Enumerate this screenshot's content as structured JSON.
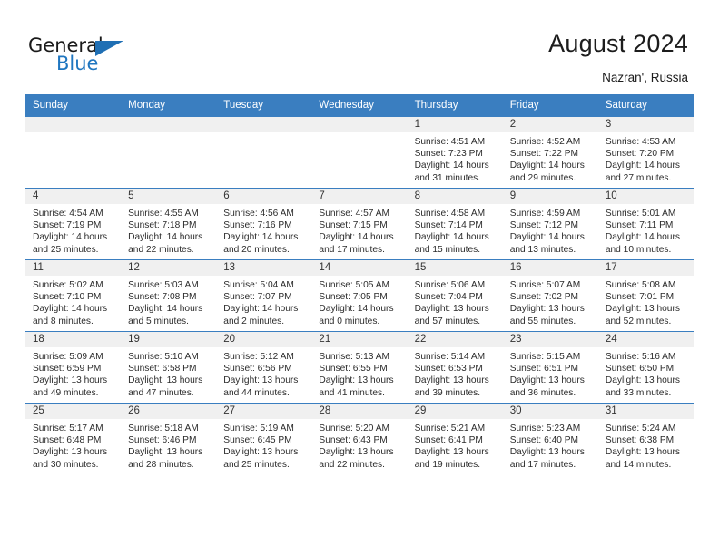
{
  "brand": {
    "name_part1": "General",
    "name_part2": "Blue",
    "flag_icon": "triangle-flag-icon",
    "accent_color": "#1f6fb4"
  },
  "header": {
    "title": "August 2024",
    "location": "Nazran', Russia"
  },
  "theme": {
    "header_bg": "#3a7ec0",
    "header_text": "#ffffff",
    "daynum_band_bg": "#f0f0f0",
    "cell_bg": "#ffffff",
    "grid_line": "#3a7ec0",
    "body_text": "#2b2b2b"
  },
  "calendar": {
    "weekday_headers": [
      "Sunday",
      "Monday",
      "Tuesday",
      "Wednesday",
      "Thursday",
      "Friday",
      "Saturday"
    ],
    "labels": {
      "sunrise": "Sunrise:",
      "sunset": "Sunset:",
      "daylight": "Daylight:"
    },
    "weeks": [
      [
        {
          "day": "",
          "blank": true
        },
        {
          "day": "",
          "blank": true
        },
        {
          "day": "",
          "blank": true
        },
        {
          "day": "",
          "blank": true
        },
        {
          "day": "1",
          "sunrise": "Sunrise: 4:51 AM",
          "sunset": "Sunset: 7:23 PM",
          "daylight": "Daylight: 14 hours and 31 minutes."
        },
        {
          "day": "2",
          "sunrise": "Sunrise: 4:52 AM",
          "sunset": "Sunset: 7:22 PM",
          "daylight": "Daylight: 14 hours and 29 minutes."
        },
        {
          "day": "3",
          "sunrise": "Sunrise: 4:53 AM",
          "sunset": "Sunset: 7:20 PM",
          "daylight": "Daylight: 14 hours and 27 minutes."
        }
      ],
      [
        {
          "day": "4",
          "sunrise": "Sunrise: 4:54 AM",
          "sunset": "Sunset: 7:19 PM",
          "daylight": "Daylight: 14 hours and 25 minutes."
        },
        {
          "day": "5",
          "sunrise": "Sunrise: 4:55 AM",
          "sunset": "Sunset: 7:18 PM",
          "daylight": "Daylight: 14 hours and 22 minutes."
        },
        {
          "day": "6",
          "sunrise": "Sunrise: 4:56 AM",
          "sunset": "Sunset: 7:16 PM",
          "daylight": "Daylight: 14 hours and 20 minutes."
        },
        {
          "day": "7",
          "sunrise": "Sunrise: 4:57 AM",
          "sunset": "Sunset: 7:15 PM",
          "daylight": "Daylight: 14 hours and 17 minutes."
        },
        {
          "day": "8",
          "sunrise": "Sunrise: 4:58 AM",
          "sunset": "Sunset: 7:14 PM",
          "daylight": "Daylight: 14 hours and 15 minutes."
        },
        {
          "day": "9",
          "sunrise": "Sunrise: 4:59 AM",
          "sunset": "Sunset: 7:12 PM",
          "daylight": "Daylight: 14 hours and 13 minutes."
        },
        {
          "day": "10",
          "sunrise": "Sunrise: 5:01 AM",
          "sunset": "Sunset: 7:11 PM",
          "daylight": "Daylight: 14 hours and 10 minutes."
        }
      ],
      [
        {
          "day": "11",
          "sunrise": "Sunrise: 5:02 AM",
          "sunset": "Sunset: 7:10 PM",
          "daylight": "Daylight: 14 hours and 8 minutes."
        },
        {
          "day": "12",
          "sunrise": "Sunrise: 5:03 AM",
          "sunset": "Sunset: 7:08 PM",
          "daylight": "Daylight: 14 hours and 5 minutes."
        },
        {
          "day": "13",
          "sunrise": "Sunrise: 5:04 AM",
          "sunset": "Sunset: 7:07 PM",
          "daylight": "Daylight: 14 hours and 2 minutes."
        },
        {
          "day": "14",
          "sunrise": "Sunrise: 5:05 AM",
          "sunset": "Sunset: 7:05 PM",
          "daylight": "Daylight: 14 hours and 0 minutes."
        },
        {
          "day": "15",
          "sunrise": "Sunrise: 5:06 AM",
          "sunset": "Sunset: 7:04 PM",
          "daylight": "Daylight: 13 hours and 57 minutes."
        },
        {
          "day": "16",
          "sunrise": "Sunrise: 5:07 AM",
          "sunset": "Sunset: 7:02 PM",
          "daylight": "Daylight: 13 hours and 55 minutes."
        },
        {
          "day": "17",
          "sunrise": "Sunrise: 5:08 AM",
          "sunset": "Sunset: 7:01 PM",
          "daylight": "Daylight: 13 hours and 52 minutes."
        }
      ],
      [
        {
          "day": "18",
          "sunrise": "Sunrise: 5:09 AM",
          "sunset": "Sunset: 6:59 PM",
          "daylight": "Daylight: 13 hours and 49 minutes."
        },
        {
          "day": "19",
          "sunrise": "Sunrise: 5:10 AM",
          "sunset": "Sunset: 6:58 PM",
          "daylight": "Daylight: 13 hours and 47 minutes."
        },
        {
          "day": "20",
          "sunrise": "Sunrise: 5:12 AM",
          "sunset": "Sunset: 6:56 PM",
          "daylight": "Daylight: 13 hours and 44 minutes."
        },
        {
          "day": "21",
          "sunrise": "Sunrise: 5:13 AM",
          "sunset": "Sunset: 6:55 PM",
          "daylight": "Daylight: 13 hours and 41 minutes."
        },
        {
          "day": "22",
          "sunrise": "Sunrise: 5:14 AM",
          "sunset": "Sunset: 6:53 PM",
          "daylight": "Daylight: 13 hours and 39 minutes."
        },
        {
          "day": "23",
          "sunrise": "Sunrise: 5:15 AM",
          "sunset": "Sunset: 6:51 PM",
          "daylight": "Daylight: 13 hours and 36 minutes."
        },
        {
          "day": "24",
          "sunrise": "Sunrise: 5:16 AM",
          "sunset": "Sunset: 6:50 PM",
          "daylight": "Daylight: 13 hours and 33 minutes."
        }
      ],
      [
        {
          "day": "25",
          "sunrise": "Sunrise: 5:17 AM",
          "sunset": "Sunset: 6:48 PM",
          "daylight": "Daylight: 13 hours and 30 minutes."
        },
        {
          "day": "26",
          "sunrise": "Sunrise: 5:18 AM",
          "sunset": "Sunset: 6:46 PM",
          "daylight": "Daylight: 13 hours and 28 minutes."
        },
        {
          "day": "27",
          "sunrise": "Sunrise: 5:19 AM",
          "sunset": "Sunset: 6:45 PM",
          "daylight": "Daylight: 13 hours and 25 minutes."
        },
        {
          "day": "28",
          "sunrise": "Sunrise: 5:20 AM",
          "sunset": "Sunset: 6:43 PM",
          "daylight": "Daylight: 13 hours and 22 minutes."
        },
        {
          "day": "29",
          "sunrise": "Sunrise: 5:21 AM",
          "sunset": "Sunset: 6:41 PM",
          "daylight": "Daylight: 13 hours and 19 minutes."
        },
        {
          "day": "30",
          "sunrise": "Sunrise: 5:23 AM",
          "sunset": "Sunset: 6:40 PM",
          "daylight": "Daylight: 13 hours and 17 minutes."
        },
        {
          "day": "31",
          "sunrise": "Sunrise: 5:24 AM",
          "sunset": "Sunset: 6:38 PM",
          "daylight": "Daylight: 13 hours and 14 minutes."
        }
      ]
    ]
  }
}
